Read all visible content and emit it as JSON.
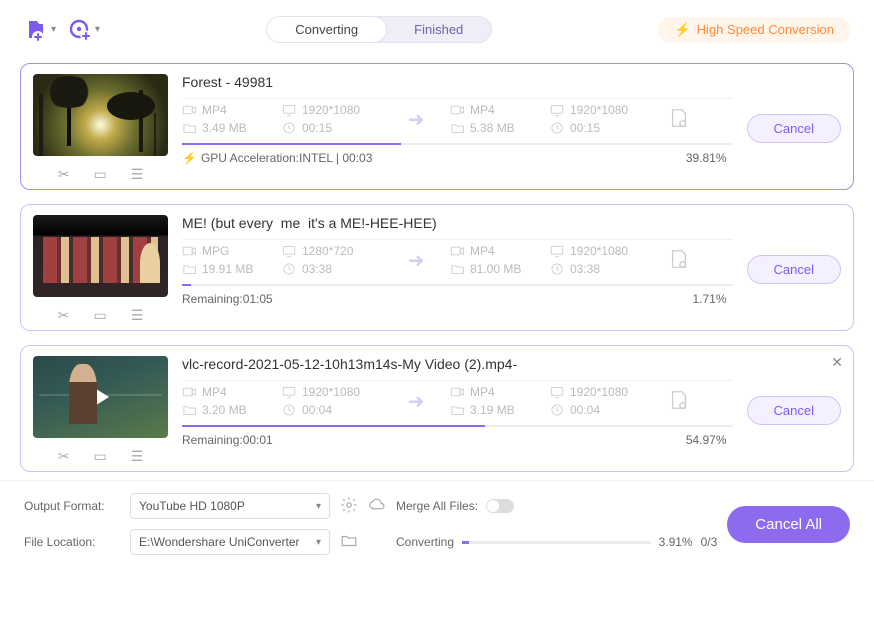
{
  "topbar": {
    "tabs": {
      "converting": "Converting",
      "finished": "Finished"
    },
    "high_speed": "High Speed Conversion"
  },
  "items": [
    {
      "title": "Forest - 49981",
      "src": {
        "fmt": "MP4",
        "res": "1920*1080",
        "size": "3.49 MB",
        "dur": "00:15"
      },
      "dst": {
        "fmt": "MP4",
        "res": "1920*1080",
        "size": "5.38 MB",
        "dur": "00:15"
      },
      "progress_label": "GPU Acceleration:INTEL | 00:03",
      "progress_bolt": true,
      "percent": "39.81%",
      "pct_val": 39.81,
      "cancel": "Cancel",
      "has_play": false,
      "has_close": false
    },
    {
      "title": "ME! (but every  me  it's a ME!-HEE-HEE)",
      "src": {
        "fmt": "MPG",
        "res": "1280*720",
        "size": "19.91 MB",
        "dur": "03:38"
      },
      "dst": {
        "fmt": "MP4",
        "res": "1920*1080",
        "size": "81.00 MB",
        "dur": "03:38"
      },
      "progress_label": "Remaining:01:05",
      "progress_bolt": false,
      "percent": "1.71%",
      "pct_val": 1.71,
      "cancel": "Cancel",
      "has_play": false,
      "has_close": false
    },
    {
      "title": "vlc-record-2021-05-12-10h13m14s-My Video (2).mp4-",
      "src": {
        "fmt": "MP4",
        "res": "1920*1080",
        "size": "3.20 MB",
        "dur": "00:04"
      },
      "dst": {
        "fmt": "MP4",
        "res": "1920*1080",
        "size": "3.19 MB",
        "dur": "00:04"
      },
      "progress_label": "Remaining:00:01",
      "progress_bolt": false,
      "percent": "54.97%",
      "pct_val": 54.97,
      "cancel": "Cancel",
      "has_play": true,
      "has_close": true
    }
  ],
  "footer": {
    "output_format_label": "Output Format:",
    "output_format_value": "YouTube HD 1080P",
    "merge_label": "Merge All Files:",
    "file_location_label": "File Location:",
    "file_location_value": "E:\\Wondershare UniConverter",
    "converting_label": "Converting",
    "overall_percent": "3.91%",
    "overall_count": "0/3",
    "overall_val": 3.91,
    "cancel_all": "Cancel All"
  }
}
